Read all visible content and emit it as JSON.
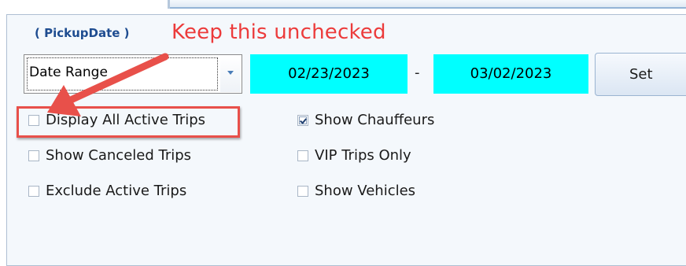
{
  "group": {
    "label": "( PickupDate )"
  },
  "annotation": {
    "text": "Keep this unchecked",
    "color": "#ec3b3b"
  },
  "filters": {
    "date_mode": "Date Range",
    "start_date": "02/23/2023",
    "separator": "-",
    "end_date": "03/02/2023",
    "set_label": "Set"
  },
  "options": {
    "left": [
      {
        "label": "Display All Active Trips",
        "checked": false
      },
      {
        "label": "Show Canceled Trips",
        "checked": false
      },
      {
        "label": "Exclude Active Trips",
        "checked": false
      }
    ],
    "right": [
      {
        "label": "Show Chauffeurs",
        "checked": true
      },
      {
        "label": "VIP Trips Only",
        "checked": false
      },
      {
        "label": "Show Vehicles",
        "checked": false
      }
    ]
  },
  "colors": {
    "date_field_bg": "#00ffff",
    "group_label": "#1e4c90",
    "highlight": "#e8504a"
  }
}
